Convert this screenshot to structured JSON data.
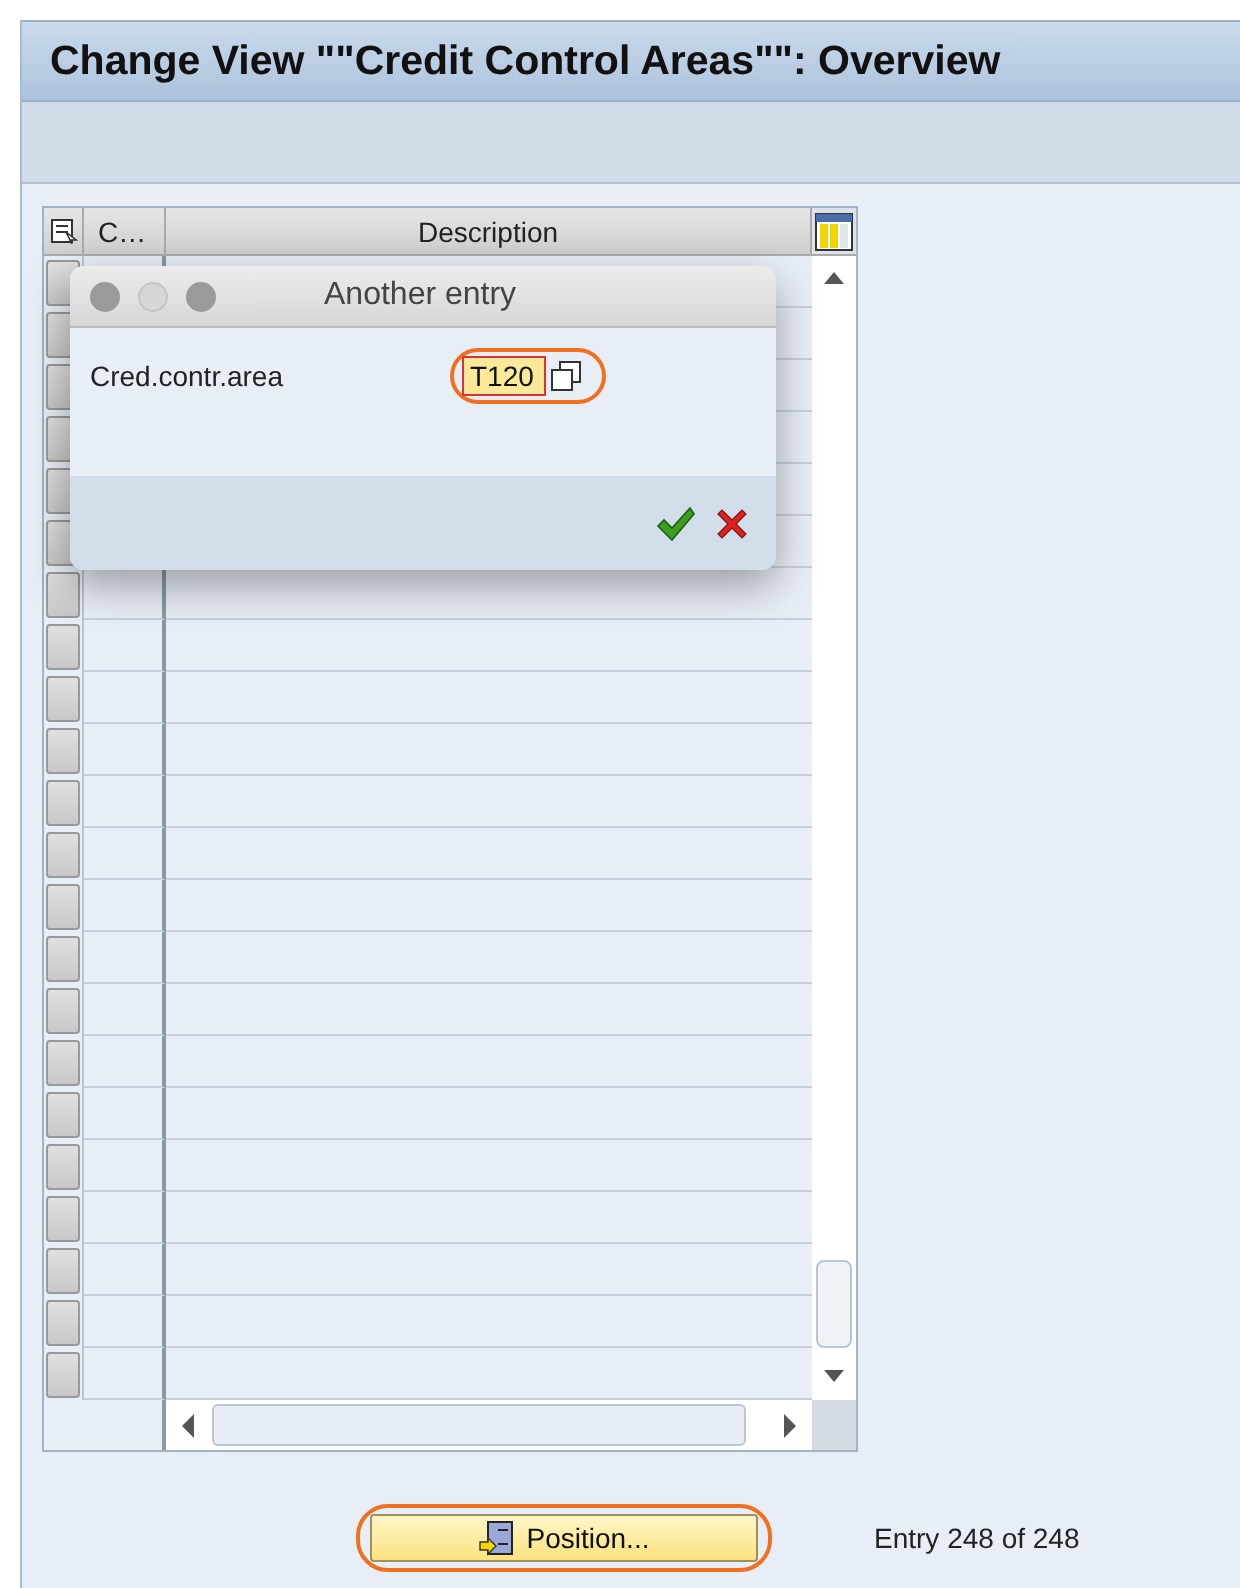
{
  "window": {
    "title": "Change View \"\"Credit Control Areas\"\": Overview"
  },
  "table": {
    "columns": [
      {
        "label": "C…"
      },
      {
        "label": "Description"
      }
    ]
  },
  "dialog": {
    "title": "Another entry",
    "fields": [
      {
        "label": "Cred.contr.area",
        "value": "T120",
        "highlighted": true
      }
    ],
    "buttons": [
      {
        "kind": "confirm"
      },
      {
        "kind": "cancel"
      }
    ]
  },
  "position_button": {
    "label": "Position...",
    "highlighted": true
  },
  "entry_info": "Entry 248 of 248"
}
